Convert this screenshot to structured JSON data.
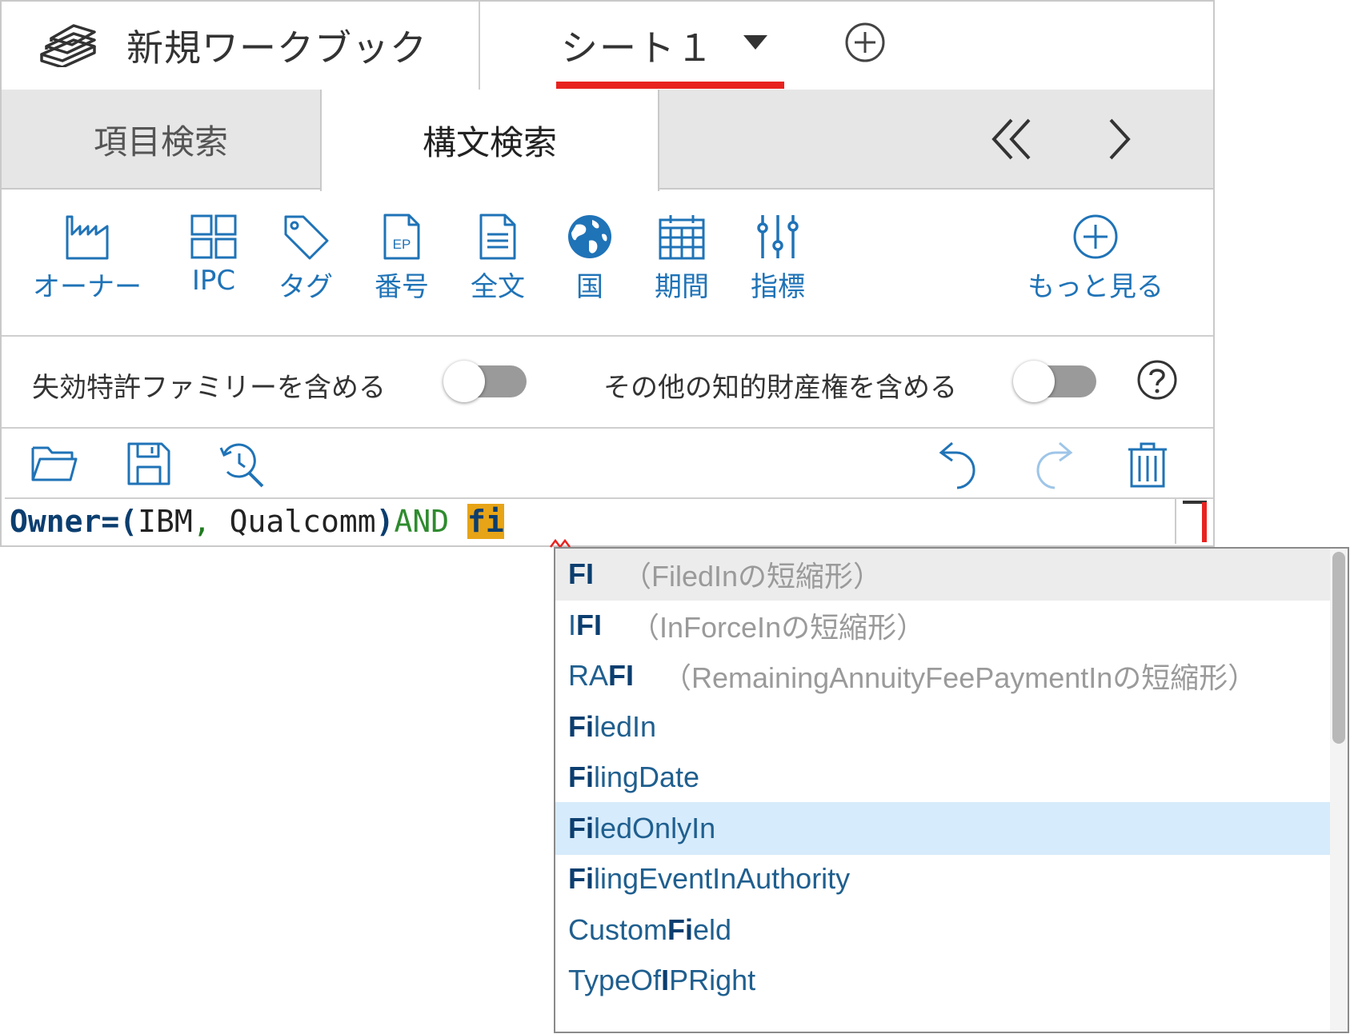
{
  "header": {
    "workbook_title": "新規ワークブック",
    "sheet_label": "シート１"
  },
  "tabs": {
    "item_search": "項目検索",
    "syntax_search": "構文検索"
  },
  "tools": [
    {
      "label": "オーナー",
      "icon": "factory-icon"
    },
    {
      "label": "IPC",
      "icon": "grid-icon"
    },
    {
      "label": "タグ",
      "icon": "tag-icon"
    },
    {
      "label": "番号",
      "icon": "document-ep-icon"
    },
    {
      "label": "全文",
      "icon": "document-text-icon"
    },
    {
      "label": "国",
      "icon": "globe-icon"
    },
    {
      "label": "期間",
      "icon": "calendar-icon"
    },
    {
      "label": "指標",
      "icon": "sliders-icon"
    },
    {
      "label": "もっと見る",
      "icon": "plus-circle-icon"
    }
  ],
  "options": {
    "expired_family_label": "失効特許ファミリーを含める",
    "other_ip_label": "その他の知的財産権を含める",
    "expired_family_on": false,
    "other_ip_on": false
  },
  "editor": {
    "owner_key": "Owner",
    "eq_open": "=(",
    "ibm": "IBM",
    "comma": ",",
    "qualcomm": " Qualcomm",
    "close": ")",
    "and_op": "AND",
    "typed": "fi"
  },
  "autocomplete": {
    "items": [
      {
        "pre": "",
        "match": "FI",
        "post": "",
        "hint": "（FiledInの短縮形）"
      },
      {
        "pre": "I",
        "match": "FI",
        "post": "",
        "hint": "（InForceInの短縮形）"
      },
      {
        "pre": "RA",
        "match": "FI",
        "post": "",
        "hint": "（RemainingAnnuityFeePaymentInの短縮形）"
      },
      {
        "pre": "",
        "match": "Fi",
        "post": "ledIn",
        "hint": ""
      },
      {
        "pre": "",
        "match": "Fi",
        "post": "lingDate",
        "hint": ""
      },
      {
        "pre": "",
        "match": "Fi",
        "post": "ledOnlyIn",
        "hint": ""
      },
      {
        "pre": "",
        "match": "Fi",
        "post": "lingEventInAuthority",
        "hint": ""
      },
      {
        "pre": "Custom",
        "match": "Fi",
        "post": "eld",
        "hint": ""
      },
      {
        "pre": "TypeOf",
        "match": "I",
        "post": "PRight",
        "hint": ""
      }
    ],
    "selected_index": 5
  },
  "colors": {
    "accent_blue": "#1f73b7",
    "active_underline": "#e8231f",
    "highlight": "#e7a417",
    "selected_row": "#d6ebfb"
  }
}
